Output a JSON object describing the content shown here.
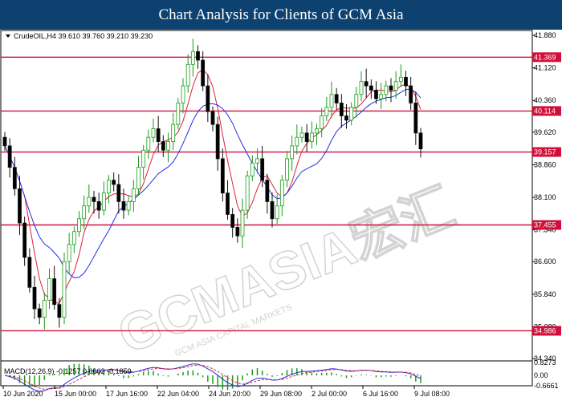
{
  "header": {
    "title": "Chart Analysis for Clients of GCM Asia"
  },
  "watermark": {
    "text": "GCMASIA宏汇",
    "subtext": "GCM ASIA CAPITAL MARKETS"
  },
  "chart_data": [
    {
      "type": "candlestick",
      "symbol_info": "CrudeOIL,H4  39.610 39.760 39.210 39.230",
      "ylim": [
        34.34,
        41.88
      ],
      "y_ticks": [
        "41.880",
        "41.120",
        "40.360",
        "39.620",
        "38.860",
        "38.100",
        "37.340",
        "36.600",
        "35.840",
        "35.080",
        "34.340"
      ],
      "x_labels": [
        "10 Jun 2020",
        "15 Jun 00:00",
        "17 Jun 16:00",
        "22 Jun 04:00",
        "24 Jun 20:00",
        "29 Jun 08:00",
        "2 Jul 00:00",
        "6 Jul 16:00",
        "9 Jul 08:00"
      ],
      "levels": [
        {
          "value": 41.369,
          "label": "41.369"
        },
        {
          "value": 40.114,
          "label": "40.114"
        },
        {
          "value": 39.157,
          "label": "39.157"
        },
        {
          "value": 37.455,
          "label": "37.455"
        },
        {
          "value": 34.986,
          "label": "34.986"
        }
      ],
      "colors": {
        "up": "#1a9c1a",
        "down": "#111111",
        "ma_fast": "#e0203a",
        "ma_slow": "#2030e0",
        "level": "#d0103a"
      },
      "close": [
        39.3,
        38.8,
        38.3,
        37.5,
        36.7,
        36.0,
        35.5,
        35.3,
        35.7,
        36.2,
        35.6,
        35.3,
        36.6,
        37.0,
        37.3,
        37.6,
        37.9,
        38.1,
        38.0,
        37.8,
        38.2,
        38.5,
        38.4,
        38.0,
        37.8,
        38.0,
        38.3,
        38.8,
        39.2,
        39.5,
        39.7,
        39.4,
        39.2,
        39.4,
        39.8,
        40.3,
        40.7,
        41.2,
        41.5,
        41.3,
        40.7,
        40.1,
        39.8,
        39.0,
        38.2,
        37.7,
        37.4,
        37.2,
        37.8,
        38.6,
        38.9,
        39.0,
        38.5,
        38.0,
        37.6,
        37.9,
        38.5,
        39.0,
        39.3,
        39.5,
        39.6,
        39.4,
        39.6,
        39.7,
        40.0,
        40.2,
        40.5,
        40.3,
        40.0,
        39.9,
        40.2,
        40.5,
        40.8,
        40.7,
        40.6,
        40.4,
        40.5,
        40.7,
        40.6,
        40.8,
        40.9,
        40.7,
        40.3,
        39.6,
        39.23
      ]
    },
    {
      "type": "macd",
      "label": "MACD(12,26,9) -0.1257 0.0602 -0.1859",
      "ylim": [
        -0.6661,
        0.8273
      ],
      "y_ticks": [
        "0.8273",
        "0.00",
        "-0.6661"
      ]
    }
  ]
}
